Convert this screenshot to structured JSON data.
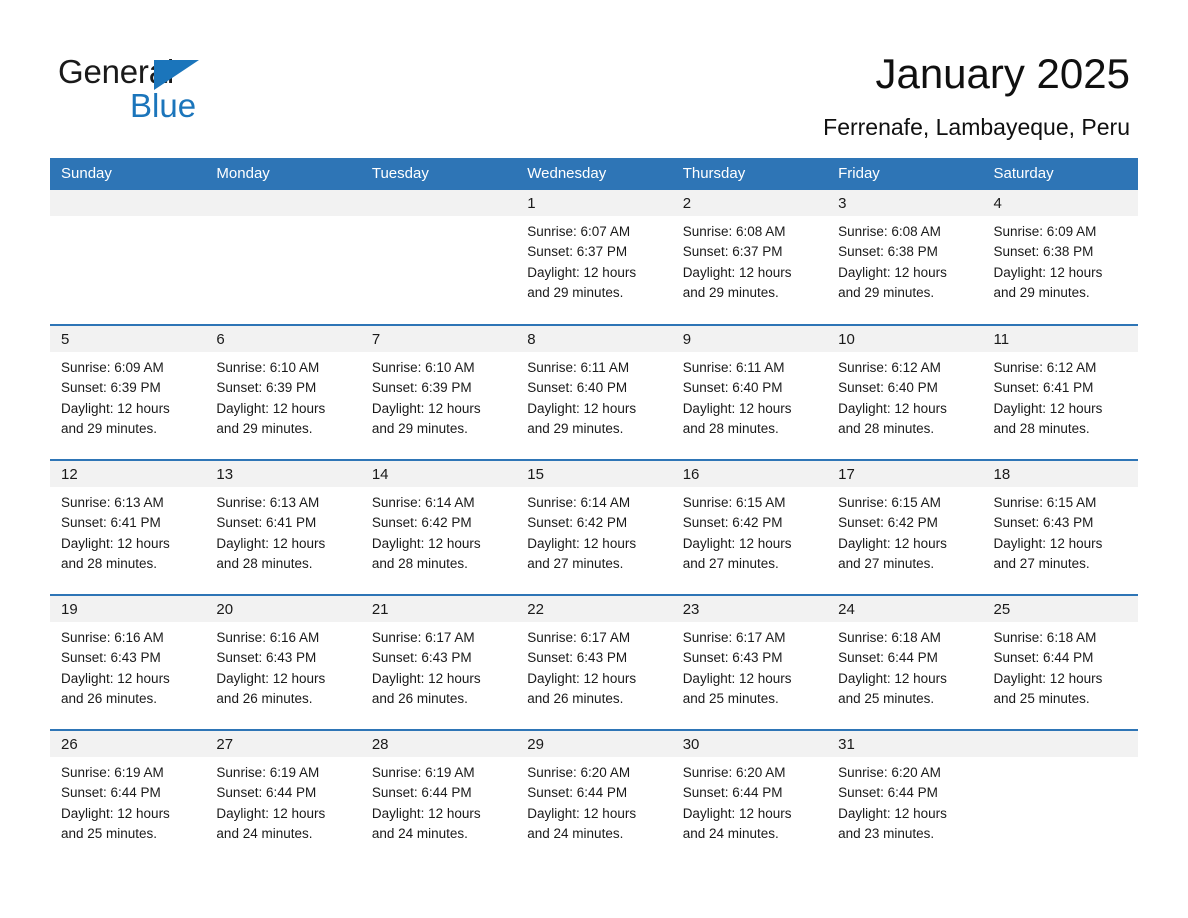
{
  "logo": {
    "word_general": "General",
    "word_blue": "Blue",
    "triangle_color": "#1b75bb"
  },
  "header": {
    "title": "January 2025",
    "subtitle": "Ferrenafe, Lambayeque, Peru"
  },
  "colors": {
    "header_blue": "#2e75b6",
    "daynum_band": "#f2f2f2",
    "text": "#1a1a1a"
  },
  "weekday_headers": [
    "Sunday",
    "Monday",
    "Tuesday",
    "Wednesday",
    "Thursday",
    "Friday",
    "Saturday"
  ],
  "weeks": [
    [
      {
        "day": "",
        "sunrise": "",
        "sunset": "",
        "daylight1": "",
        "daylight2": ""
      },
      {
        "day": "",
        "sunrise": "",
        "sunset": "",
        "daylight1": "",
        "daylight2": ""
      },
      {
        "day": "",
        "sunrise": "",
        "sunset": "",
        "daylight1": "",
        "daylight2": ""
      },
      {
        "day": "1",
        "sunrise": "Sunrise: 6:07 AM",
        "sunset": "Sunset: 6:37 PM",
        "daylight1": "Daylight: 12 hours",
        "daylight2": "and 29 minutes."
      },
      {
        "day": "2",
        "sunrise": "Sunrise: 6:08 AM",
        "sunset": "Sunset: 6:37 PM",
        "daylight1": "Daylight: 12 hours",
        "daylight2": "and 29 minutes."
      },
      {
        "day": "3",
        "sunrise": "Sunrise: 6:08 AM",
        "sunset": "Sunset: 6:38 PM",
        "daylight1": "Daylight: 12 hours",
        "daylight2": "and 29 minutes."
      },
      {
        "day": "4",
        "sunrise": "Sunrise: 6:09 AM",
        "sunset": "Sunset: 6:38 PM",
        "daylight1": "Daylight: 12 hours",
        "daylight2": "and 29 minutes."
      }
    ],
    [
      {
        "day": "5",
        "sunrise": "Sunrise: 6:09 AM",
        "sunset": "Sunset: 6:39 PM",
        "daylight1": "Daylight: 12 hours",
        "daylight2": "and 29 minutes."
      },
      {
        "day": "6",
        "sunrise": "Sunrise: 6:10 AM",
        "sunset": "Sunset: 6:39 PM",
        "daylight1": "Daylight: 12 hours",
        "daylight2": "and 29 minutes."
      },
      {
        "day": "7",
        "sunrise": "Sunrise: 6:10 AM",
        "sunset": "Sunset: 6:39 PM",
        "daylight1": "Daylight: 12 hours",
        "daylight2": "and 29 minutes."
      },
      {
        "day": "8",
        "sunrise": "Sunrise: 6:11 AM",
        "sunset": "Sunset: 6:40 PM",
        "daylight1": "Daylight: 12 hours",
        "daylight2": "and 29 minutes."
      },
      {
        "day": "9",
        "sunrise": "Sunrise: 6:11 AM",
        "sunset": "Sunset: 6:40 PM",
        "daylight1": "Daylight: 12 hours",
        "daylight2": "and 28 minutes."
      },
      {
        "day": "10",
        "sunrise": "Sunrise: 6:12 AM",
        "sunset": "Sunset: 6:40 PM",
        "daylight1": "Daylight: 12 hours",
        "daylight2": "and 28 minutes."
      },
      {
        "day": "11",
        "sunrise": "Sunrise: 6:12 AM",
        "sunset": "Sunset: 6:41 PM",
        "daylight1": "Daylight: 12 hours",
        "daylight2": "and 28 minutes."
      }
    ],
    [
      {
        "day": "12",
        "sunrise": "Sunrise: 6:13 AM",
        "sunset": "Sunset: 6:41 PM",
        "daylight1": "Daylight: 12 hours",
        "daylight2": "and 28 minutes."
      },
      {
        "day": "13",
        "sunrise": "Sunrise: 6:13 AM",
        "sunset": "Sunset: 6:41 PM",
        "daylight1": "Daylight: 12 hours",
        "daylight2": "and 28 minutes."
      },
      {
        "day": "14",
        "sunrise": "Sunrise: 6:14 AM",
        "sunset": "Sunset: 6:42 PM",
        "daylight1": "Daylight: 12 hours",
        "daylight2": "and 28 minutes."
      },
      {
        "day": "15",
        "sunrise": "Sunrise: 6:14 AM",
        "sunset": "Sunset: 6:42 PM",
        "daylight1": "Daylight: 12 hours",
        "daylight2": "and 27 minutes."
      },
      {
        "day": "16",
        "sunrise": "Sunrise: 6:15 AM",
        "sunset": "Sunset: 6:42 PM",
        "daylight1": "Daylight: 12 hours",
        "daylight2": "and 27 minutes."
      },
      {
        "day": "17",
        "sunrise": "Sunrise: 6:15 AM",
        "sunset": "Sunset: 6:42 PM",
        "daylight1": "Daylight: 12 hours",
        "daylight2": "and 27 minutes."
      },
      {
        "day": "18",
        "sunrise": "Sunrise: 6:15 AM",
        "sunset": "Sunset: 6:43 PM",
        "daylight1": "Daylight: 12 hours",
        "daylight2": "and 27 minutes."
      }
    ],
    [
      {
        "day": "19",
        "sunrise": "Sunrise: 6:16 AM",
        "sunset": "Sunset: 6:43 PM",
        "daylight1": "Daylight: 12 hours",
        "daylight2": "and 26 minutes."
      },
      {
        "day": "20",
        "sunrise": "Sunrise: 6:16 AM",
        "sunset": "Sunset: 6:43 PM",
        "daylight1": "Daylight: 12 hours",
        "daylight2": "and 26 minutes."
      },
      {
        "day": "21",
        "sunrise": "Sunrise: 6:17 AM",
        "sunset": "Sunset: 6:43 PM",
        "daylight1": "Daylight: 12 hours",
        "daylight2": "and 26 minutes."
      },
      {
        "day": "22",
        "sunrise": "Sunrise: 6:17 AM",
        "sunset": "Sunset: 6:43 PM",
        "daylight1": "Daylight: 12 hours",
        "daylight2": "and 26 minutes."
      },
      {
        "day": "23",
        "sunrise": "Sunrise: 6:17 AM",
        "sunset": "Sunset: 6:43 PM",
        "daylight1": "Daylight: 12 hours",
        "daylight2": "and 25 minutes."
      },
      {
        "day": "24",
        "sunrise": "Sunrise: 6:18 AM",
        "sunset": "Sunset: 6:44 PM",
        "daylight1": "Daylight: 12 hours",
        "daylight2": "and 25 minutes."
      },
      {
        "day": "25",
        "sunrise": "Sunrise: 6:18 AM",
        "sunset": "Sunset: 6:44 PM",
        "daylight1": "Daylight: 12 hours",
        "daylight2": "and 25 minutes."
      }
    ],
    [
      {
        "day": "26",
        "sunrise": "Sunrise: 6:19 AM",
        "sunset": "Sunset: 6:44 PM",
        "daylight1": "Daylight: 12 hours",
        "daylight2": "and 25 minutes."
      },
      {
        "day": "27",
        "sunrise": "Sunrise: 6:19 AM",
        "sunset": "Sunset: 6:44 PM",
        "daylight1": "Daylight: 12 hours",
        "daylight2": "and 24 minutes."
      },
      {
        "day": "28",
        "sunrise": "Sunrise: 6:19 AM",
        "sunset": "Sunset: 6:44 PM",
        "daylight1": "Daylight: 12 hours",
        "daylight2": "and 24 minutes."
      },
      {
        "day": "29",
        "sunrise": "Sunrise: 6:20 AM",
        "sunset": "Sunset: 6:44 PM",
        "daylight1": "Daylight: 12 hours",
        "daylight2": "and 24 minutes."
      },
      {
        "day": "30",
        "sunrise": "Sunrise: 6:20 AM",
        "sunset": "Sunset: 6:44 PM",
        "daylight1": "Daylight: 12 hours",
        "daylight2": "and 24 minutes."
      },
      {
        "day": "31",
        "sunrise": "Sunrise: 6:20 AM",
        "sunset": "Sunset: 6:44 PM",
        "daylight1": "Daylight: 12 hours",
        "daylight2": "and 23 minutes."
      },
      {
        "day": "",
        "sunrise": "",
        "sunset": "",
        "daylight1": "",
        "daylight2": ""
      }
    ]
  ]
}
